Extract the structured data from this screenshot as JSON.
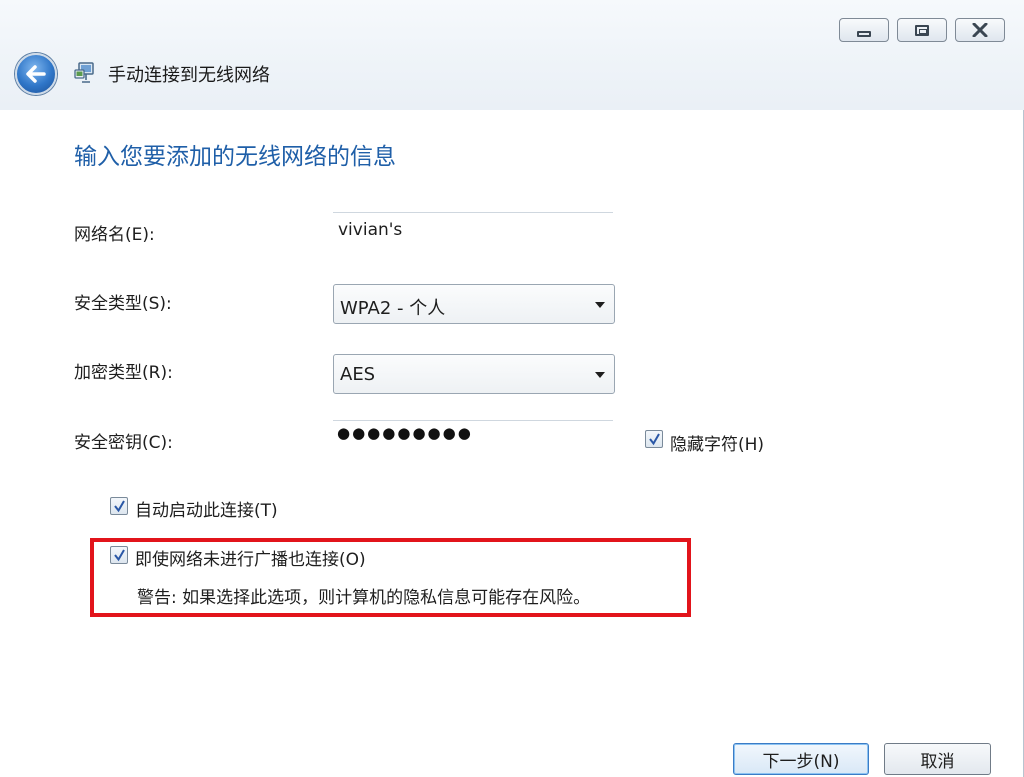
{
  "window": {
    "title": "手动连接到无线网络",
    "buttons": {
      "minimize": "minimize",
      "maximize": "maximize",
      "close": "close"
    }
  },
  "heading": "输入您要添加的无线网络的信息",
  "form": {
    "network_name": {
      "label": "网络名(E):",
      "value": "vivian's"
    },
    "security_type": {
      "label": "安全类型(S):",
      "value": "WPA2 - 个人"
    },
    "encryption_type": {
      "label": "加密类型(R):",
      "value": "AES"
    },
    "security_key": {
      "label": "安全密钥(C):",
      "value": "●●●●●●●●●"
    },
    "hide_chars": {
      "label": "隐藏字符(H)",
      "checked": true
    }
  },
  "options": {
    "auto_start": {
      "label": "自动启动此连接(T)",
      "checked": true
    },
    "connect_hidden": {
      "label": "即使网络未进行广播也连接(O)",
      "checked": true
    },
    "warning": "警告: 如果选择此选项，则计算机的隐私信息可能存在风险。"
  },
  "footer": {
    "next_label": "下一步(N)",
    "cancel_label": "取消"
  },
  "colors": {
    "heading": "#1f5fa8",
    "highlight_box": "#e2141b"
  },
  "icons": {
    "back": "back-arrow-icon",
    "network": "network-icon",
    "check": "checkmark-icon"
  }
}
